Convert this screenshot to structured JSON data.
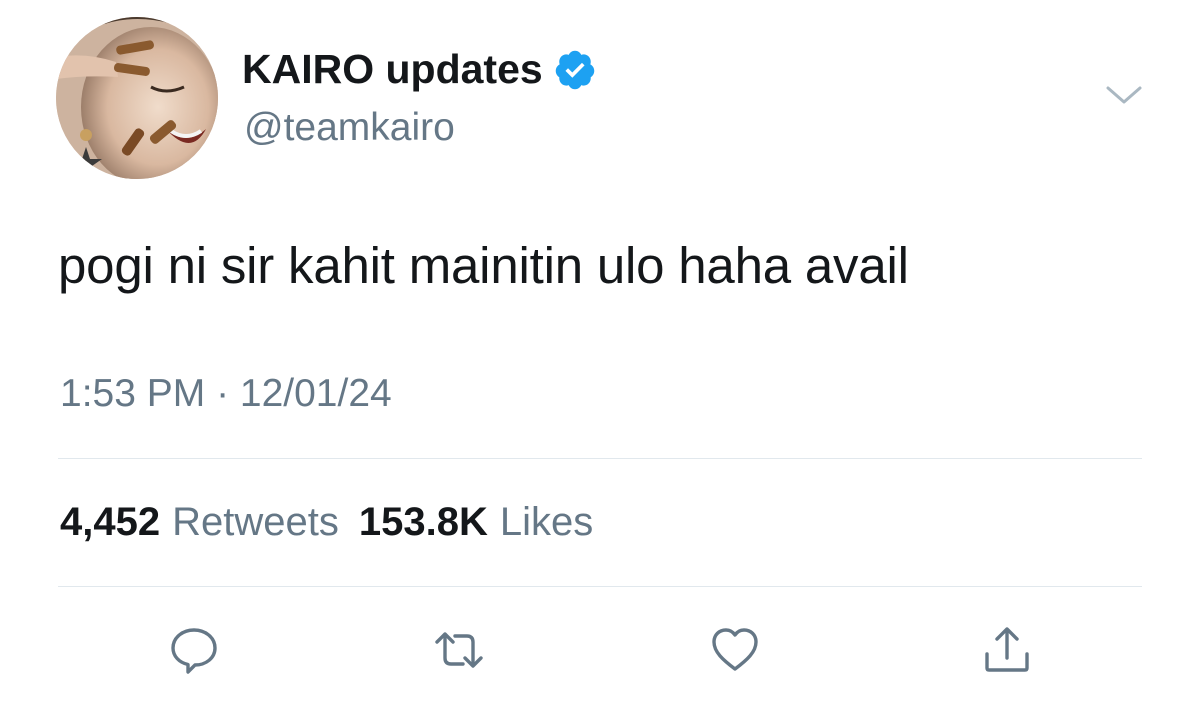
{
  "tweet": {
    "author": {
      "display_name": "KAIRO updates",
      "handle": "@teamkairo",
      "verified": true,
      "avatar_icon": "profile-photo"
    },
    "text": "pogi ni sir kahit mainitin ulo haha avail",
    "timestamp": "1:53 PM · 12/01/24",
    "stats": {
      "retweets_count": "4,452",
      "retweets_label": "Retweets",
      "likes_count": "153.8K",
      "likes_label": "Likes"
    },
    "menu_icon": "chevron-down-icon",
    "actions": [
      {
        "name": "reply",
        "icon": "speech-bubble-icon"
      },
      {
        "name": "retweet",
        "icon": "retweet-arrows-icon"
      },
      {
        "name": "like",
        "icon": "heart-icon"
      },
      {
        "name": "share",
        "icon": "share-upload-icon"
      }
    ]
  },
  "colors": {
    "text_primary": "#14171a",
    "text_secondary": "#657786",
    "verified_blue": "#1da1f2",
    "divider": "#e1e8ed"
  }
}
